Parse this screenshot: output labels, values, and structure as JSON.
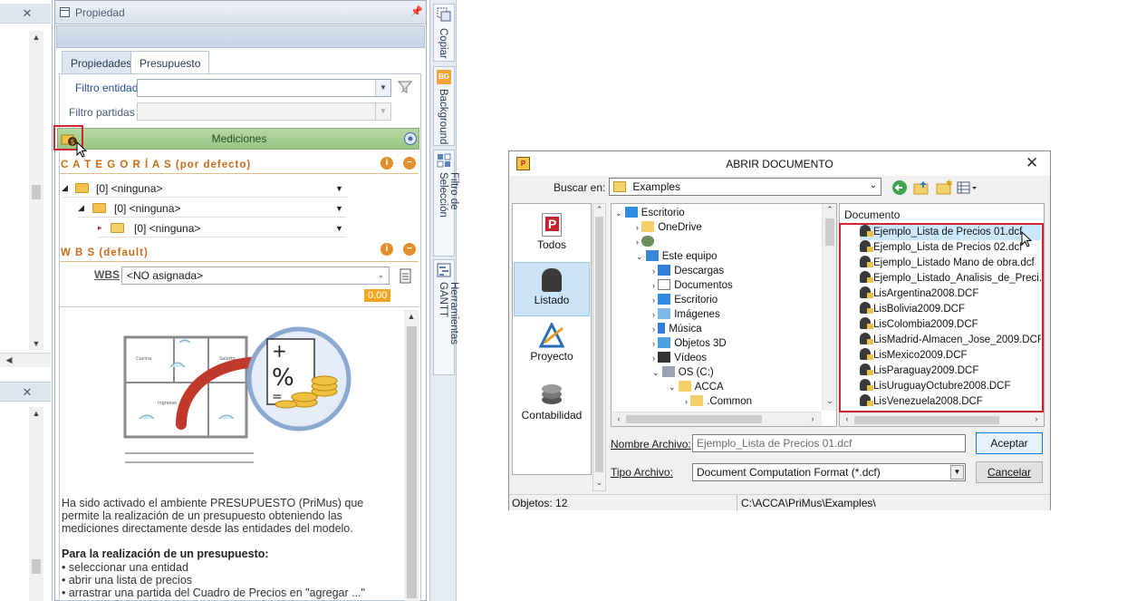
{
  "property_panel": {
    "title": "Propiedad",
    "tabs": [
      {
        "label": "Propiedades"
      },
      {
        "label": "Presupuesto"
      }
    ],
    "filtro_entidad_label": "Filtro entidad",
    "filtro_partidas_label": "Filtro partidas",
    "mediciones_label": "Mediciones",
    "categorias": {
      "title": "C A T E G O R Í A S (por defecto)",
      "rows": [
        "[0] <ninguna>",
        "[0] <ninguna>",
        "[0] <ninguna>"
      ]
    },
    "wbs": {
      "title": "W B S (default)",
      "label": "WBS",
      "value": "<NO asignada>",
      "amount": "0.00"
    },
    "description": {
      "intro": "Ha sido activado el ambiente PRESUPUESTO (PriMus) que permite la realización de un presupuesto obteniendo las mediciones directamente desde las entidades del modelo.",
      "subtitle": "Para la realización de un presupuesto:",
      "bullets": [
        "seleccionar una entidad",
        "abrir una lista de precios",
        "arrastrar una partida del Cuadro de Precios en \"agregar ...\""
      ]
    },
    "illustration": {
      "room_labels": [
        "Cucina",
        "Salotto",
        "Ingresso"
      ]
    }
  },
  "side_tabs": [
    "Copiar",
    "Background",
    "Filtro de Selección",
    "Herramientas GANTT"
  ],
  "side_tab_icon_text": "BG",
  "dialog": {
    "title": "ABRIR DOCUMENTO",
    "buscar_label": "Buscar en:",
    "buscar_value": "Examples",
    "places": [
      "Todos",
      "Listado",
      "Proyecto",
      "Contabilidad"
    ],
    "tree": [
      {
        "label": "Escritorio",
        "level": 0,
        "icon": "desktop"
      },
      {
        "label": "OneDrive",
        "level": 1,
        "icon": "folder"
      },
      {
        "label": "",
        "level": 1,
        "icon": "user"
      },
      {
        "label": "Este equipo",
        "level": 1,
        "icon": "computer"
      },
      {
        "label": "Descargas",
        "level": 2,
        "icon": "download"
      },
      {
        "label": "Documentos",
        "level": 2,
        "icon": "documents"
      },
      {
        "label": "Escritorio",
        "level": 2,
        "icon": "desktop"
      },
      {
        "label": "Imágenes",
        "level": 2,
        "icon": "images"
      },
      {
        "label": "Música",
        "level": 2,
        "icon": "music"
      },
      {
        "label": "Objetos 3D",
        "level": 2,
        "icon": "objects3d"
      },
      {
        "label": "Vídeos",
        "level": 2,
        "icon": "video"
      },
      {
        "label": "OS (C:)",
        "level": 2,
        "icon": "drive"
      },
      {
        "label": "ACCA",
        "level": 3,
        "icon": "folder"
      },
      {
        "label": ".Common",
        "level": 4,
        "icon": "folder"
      }
    ],
    "files_header": "Documento",
    "files": [
      "Ejemplo_Lista de Precios 01.dcf",
      "Ejemplo_Lista de Precios 02.dcf",
      "Ejemplo_Listado Mano de obra.dcf",
      "Ejemplo_Listado_Analisis_de_Preci...",
      "LisArgentina2008.DCF",
      "LisBolivia2009.DCF",
      "LisColombia2009.DCF",
      "LisMadrid-Almacen_Jose_2009.DCF",
      "LisMexico2009.DCF",
      "LisParaguay2009.DCF",
      "LisUruguayOctubre2008.DCF",
      "LisVenezuela2008.DCF"
    ],
    "nombre_label": "Nombre Archivo:",
    "nombre_value": "Ejemplo_Lista de Precios 01.dcf",
    "tipo_label": "Tipo Archivo:",
    "tipo_value": "Document Computation Format (*.dcf)",
    "accept_label": "Aceptar",
    "cancel_label": "Cancelar",
    "status_count": "Objetos: 12",
    "status_path": "C:\\ACCA\\PriMus\\Examples\\"
  },
  "colors": {
    "accent_red": "#d32233",
    "mediciones_green": "#a7cf93",
    "section_orange": "#c86b1a"
  }
}
